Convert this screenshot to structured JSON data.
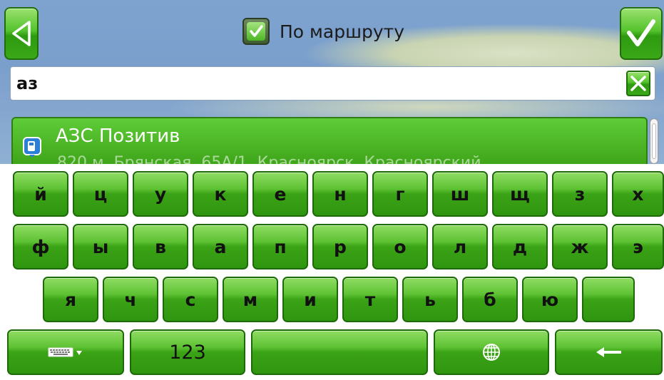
{
  "header": {
    "route_toggle_label": "По маршруту",
    "route_toggle_checked": true
  },
  "search": {
    "value": "аз"
  },
  "results": [
    {
      "title": "АЗС Позитив",
      "subtitle": "820 м, Брянская, 65А/1, Красноярск, Красноярский"
    }
  ],
  "keyboard": {
    "row1": [
      "й",
      "ц",
      "у",
      "к",
      "е",
      "н",
      "г",
      "ш",
      "щ",
      "з",
      "х"
    ],
    "row2": [
      "ф",
      "ы",
      "в",
      "а",
      "п",
      "р",
      "о",
      "л",
      "д",
      "ж",
      "э"
    ],
    "row3": [
      "я",
      "ч",
      "с",
      "м",
      "и",
      "т",
      "ь",
      "б",
      "ю",
      ""
    ],
    "numbers_label": "123"
  },
  "colors": {
    "accent_green": "#3ba316",
    "map_blue": "#7b9fcc"
  },
  "icons": {
    "back": "back-triangle-icon",
    "ok": "checkmark-icon",
    "clear": "clear-x-icon",
    "poi": "fuel-station-icon",
    "layout": "keyboard-layout-icon",
    "language": "globe-icon",
    "backspace": "backspace-arrow-icon"
  }
}
